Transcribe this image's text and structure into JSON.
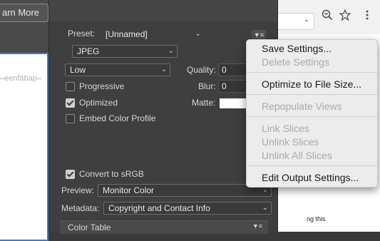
{
  "background": {
    "learn_more_label": "arn More",
    "preview_caption": "eenfabap"
  },
  "dialog": {
    "preset_label": "Preset:",
    "preset_value": "[Unnamed]",
    "format_value": "JPEG",
    "quality_preset_value": "Low",
    "quality_label": "Quality:",
    "quality_value": "0",
    "blur_label": "Blur:",
    "blur_value": "0",
    "matte_label": "Matte:",
    "matte_color": "#ffffff",
    "options": {
      "progressive": {
        "label": "Progressive",
        "checked": false
      },
      "optimized": {
        "label": "Optimized",
        "checked": true
      },
      "embed_color_profile": {
        "label": "Embed Color Profile",
        "checked": false
      },
      "convert_to_srgb": {
        "label": "Convert to sRGB",
        "checked": true
      }
    },
    "preview_label": "Preview:",
    "preview_value": "Monitor Color",
    "metadata_label": "Metadata:",
    "metadata_value": "Copyright and Contact Info",
    "color_table_label": "Color Table"
  },
  "browser": {
    "page_snippet": "ng this"
  },
  "context_menu": {
    "items": [
      {
        "label": "Save Settings...",
        "enabled": true
      },
      {
        "label": "Delete Settings",
        "enabled": false
      },
      {
        "label": "Optimize to File Size...",
        "enabled": true
      },
      {
        "label": "Repopulate Views",
        "enabled": false
      },
      {
        "label": "Link Slices",
        "enabled": false
      },
      {
        "label": "Unlink Slices",
        "enabled": false
      },
      {
        "label": "Unlink All Slices",
        "enabled": false
      },
      {
        "label": "Edit Output Settings...",
        "enabled": true
      }
    ]
  },
  "icons": {
    "zoom": "zoom-out-icon",
    "bookmark": "star-icon",
    "more": "vertical-dots-icon",
    "dialog_menu": "flyout-menu-icon"
  }
}
